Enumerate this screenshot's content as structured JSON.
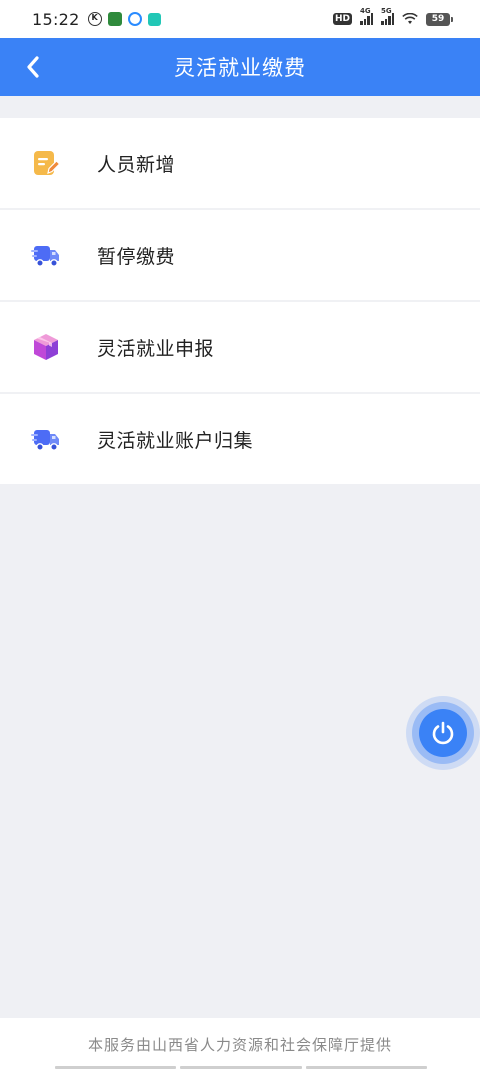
{
  "status_bar": {
    "time": "15:22",
    "battery": "59",
    "left_icons": [
      "k-icon",
      "app-icon",
      "qq-icon",
      "app-icon"
    ],
    "right_icons": [
      "hd-icon",
      "signal-4g-icon",
      "signal-5g-icon",
      "wifi-icon",
      "battery-icon"
    ],
    "net1": "4G",
    "net2": "5G",
    "hd": "HD"
  },
  "header": {
    "title": "灵活就业缴费",
    "back_icon": "chevron-left-icon",
    "background": "#3a82f6"
  },
  "menu": {
    "items": [
      {
        "label": "人员新增",
        "icon": "edit-note-icon",
        "icon_color": "#f5b94a"
      },
      {
        "label": "暂停缴费",
        "icon": "delivery-truck-icon",
        "icon_color": "#4d6cf5"
      },
      {
        "label": "灵活就业申报",
        "icon": "package-box-icon",
        "icon_color": "#c048d8"
      },
      {
        "label": "灵活就业账户归集",
        "icon": "delivery-truck-icon",
        "icon_color": "#4d6cf5"
      }
    ]
  },
  "fab": {
    "icon": "power-icon",
    "color": "#3a82f6"
  },
  "footer": {
    "text": "本服务由山西省人力资源和社会保障厅提供"
  }
}
